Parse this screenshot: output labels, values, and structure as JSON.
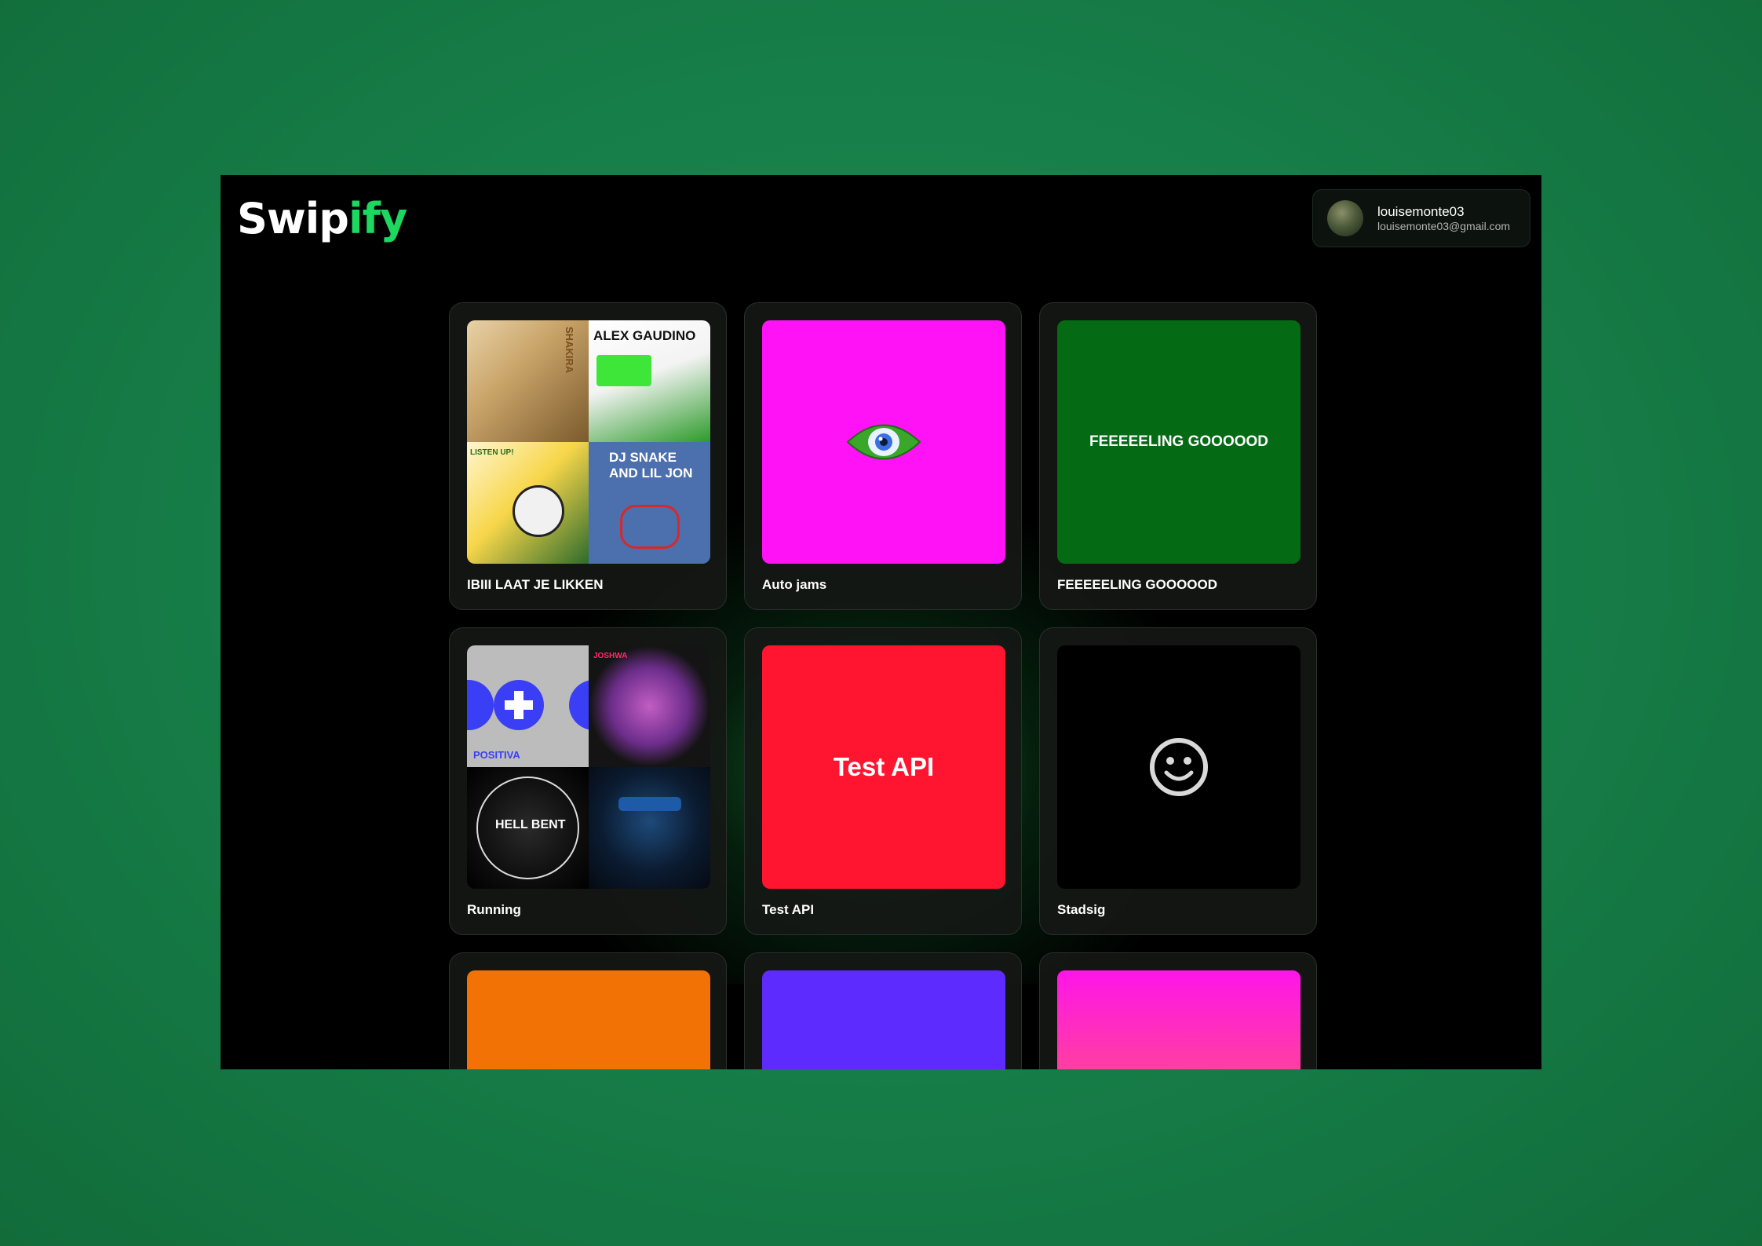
{
  "app": {
    "logo_main": "Swip",
    "logo_accent": "ify"
  },
  "user": {
    "username": "louisemonte03",
    "email": "louisemonte03@gmail.com"
  },
  "playlists": [
    {
      "title": "IBIII LAAT JE LIKKEN",
      "cover": "mosaic"
    },
    {
      "title": "Auto jams",
      "cover": "eye-emoji",
      "color": "#ff12f5"
    },
    {
      "title": "FEEEEELING GOOOOOD",
      "cover_text": "FEEEEELING GOOOOOD",
      "color": "#046a14"
    },
    {
      "title": "Running",
      "cover": "mosaic"
    },
    {
      "title": "Test API",
      "cover_text": "Test API",
      "color": "#ff1530"
    },
    {
      "title": "Stadsig",
      "cover": "smiley-icon",
      "color": "#000000"
    },
    {
      "title": "",
      "color": "#f27206"
    },
    {
      "title": "",
      "color": "#5e2bff"
    },
    {
      "title": "",
      "color": "#ff15e9"
    }
  ],
  "mosaic_tiles": {
    "shakira": "SHAKIRA",
    "alex": "ALEX GAUDINO",
    "dunk": "LISTEN UP!",
    "snake": "DJ SNAKE AND LIL JON",
    "azari": "POSITIVA",
    "joshwa": "JOSHWA",
    "hellbent": "HELL BENT",
    "swedish": ""
  }
}
